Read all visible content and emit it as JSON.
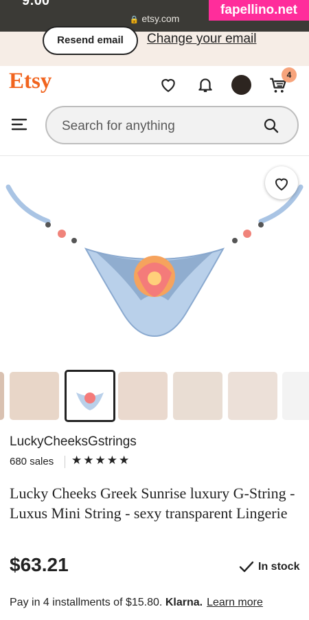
{
  "status_bar": {
    "time": "9:00",
    "url": "etsy.com",
    "lock_icon": "lock-icon"
  },
  "watermark": "fapellino.net",
  "email_banner": {
    "resend_label": "Resend email",
    "change_label": "Change your email"
  },
  "header": {
    "logo": "Etsy",
    "cart_count": "4",
    "icons": [
      "heart-icon",
      "bell-icon",
      "avatar",
      "cart-icon"
    ]
  },
  "search": {
    "placeholder": "Search for anything"
  },
  "listing": {
    "shop_name": "LuckyCheeksGstrings",
    "sales": "680 sales",
    "rating_stars": "★★★★★",
    "title": "Lucky Cheeks Greek Sunrise luxury G-String - Luxus Mini String - sexy transparent Lingerie",
    "price": "$63.21",
    "stock": "In stock",
    "installments_text": "Pay in 4 installments of $15.80.",
    "klarna": "Klarna.",
    "learn_more": "Learn more"
  },
  "colors": {
    "brand": "#f1641e",
    "badge": "#f7a47c",
    "banner_bg": "#f6ede6"
  }
}
